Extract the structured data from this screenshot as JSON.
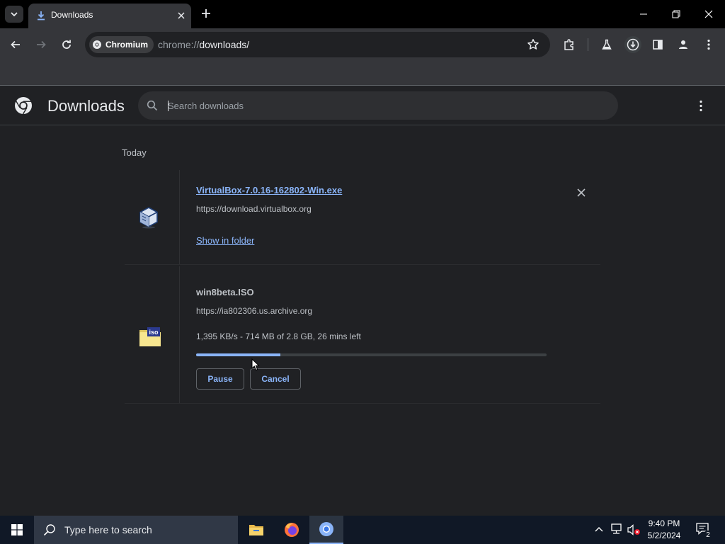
{
  "browser": {
    "tab": {
      "title": "Downloads"
    },
    "omnibox": {
      "chip_label": "Chromium",
      "url_scheme": "chrome://",
      "url_path": "downloads/"
    }
  },
  "page": {
    "title": "Downloads",
    "search": {
      "placeholder": "Search downloads",
      "value": ""
    },
    "section_date": "Today",
    "downloads": [
      {
        "file_name": "VirtualBox-7.0.16-162802-Win.exe",
        "source_url": "https://download.virtualbox.org",
        "action_label": "Show in folder",
        "icon": "virtualbox-icon"
      },
      {
        "file_name": "win8beta.ISO",
        "source_url": "https://ia802306.us.archive.org",
        "status": "1,395 KB/s - 714 MB of 2.8 GB, 26 mins left",
        "progress": 0.24,
        "pause_label": "Pause",
        "cancel_label": "Cancel",
        "icon": "iso-file-icon"
      }
    ]
  },
  "taskbar": {
    "search_placeholder": "Type here to search",
    "time": "9:40 PM",
    "date": "5/2/2024",
    "notification_count": "2"
  },
  "colors": {
    "accent": "#8ab4f8",
    "background": "#202124",
    "toolbar": "#35363a",
    "taskbar": "#101826"
  }
}
